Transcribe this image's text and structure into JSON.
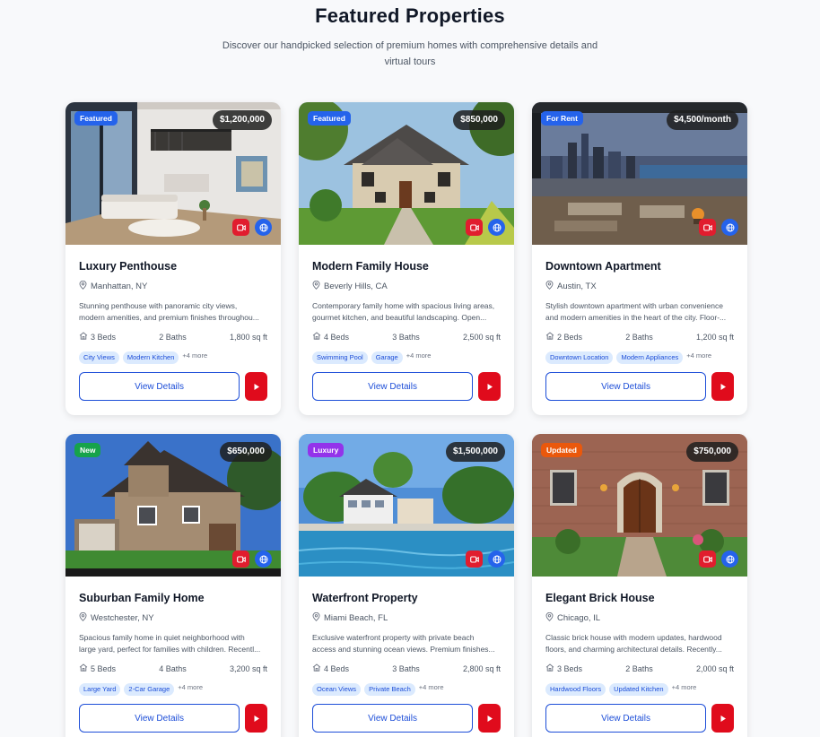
{
  "header": {
    "title": "Featured Properties",
    "subtitle": "Discover our handpicked selection of premium homes with comprehensive details and virtual tours"
  },
  "colors": {
    "accent_blue": "#1d4ed8",
    "video_red": "#e11d2e",
    "badge_featured": "#2563eb",
    "badge_rent": "#2563eb",
    "badge_new": "#16a34a",
    "badge_luxury": "#9333ea",
    "badge_updated": "#ea580c"
  },
  "properties": [
    {
      "badge": "Featured",
      "badge_color": "#2563eb",
      "price": "$1,200,000",
      "title": "Luxury Penthouse",
      "location": "Manhattan, NY",
      "desc_line1": "Stunning penthouse with panoramic city views,",
      "desc_line2": "modern amenities, and premium finishes throughou...",
      "beds": "3 Beds",
      "baths": "2 Baths",
      "sqft": "1,800 sq ft",
      "tags": [
        "City Views",
        "Modern Kitchen"
      ],
      "more": "+4 more",
      "details_label": "View Details",
      "image": "interior"
    },
    {
      "badge": "Featured",
      "badge_color": "#2563eb",
      "price": "$850,000",
      "title": "Modern Family House",
      "location": "Beverly Hills, CA",
      "desc_line1": "Contemporary family home with spacious living areas,",
      "desc_line2": "gourmet kitchen, and beautiful landscaping. Open...",
      "beds": "4 Beds",
      "baths": "3 Baths",
      "sqft": "2,500 sq ft",
      "tags": [
        "Swimming Pool",
        "Garage"
      ],
      "more": "+4 more",
      "details_label": "View Details",
      "image": "house-green"
    },
    {
      "badge": "For Rent",
      "badge_color": "#2563eb",
      "price": "$4,500/month",
      "title": "Downtown Apartment",
      "location": "Austin, TX",
      "desc_line1": "Stylish downtown apartment with urban convenience",
      "desc_line2": "and modern amenities in the heart of the city. Floor-...",
      "beds": "2 Beds",
      "baths": "2 Baths",
      "sqft": "1,200 sq ft",
      "tags": [
        "Downtown Location",
        "Modern Appliances"
      ],
      "more": "+4 more",
      "details_label": "View Details",
      "image": "city-night"
    },
    {
      "badge": "New",
      "badge_color": "#16a34a",
      "price": "$650,000",
      "title": "Suburban Family Home",
      "location": "Westchester, NY",
      "desc_line1": "Spacious family home in quiet neighborhood with",
      "desc_line2": "large yard, perfect for families with children. Recentl...",
      "beds": "5 Beds",
      "baths": "4 Baths",
      "sqft": "3,200 sq ft",
      "tags": [
        "Large Yard",
        "2-Car Garage"
      ],
      "more": "+4 more",
      "details_label": "View Details",
      "image": "stone-house"
    },
    {
      "badge": "Luxury",
      "badge_color": "#9333ea",
      "price": "$1,500,000",
      "title": "Waterfront Property",
      "location": "Miami Beach, FL",
      "desc_line1": "Exclusive waterfront property with private beach",
      "desc_line2": "access and stunning ocean views. Premium finishes...",
      "beds": "4 Beds",
      "baths": "3 Baths",
      "sqft": "2,800 sq ft",
      "tags": [
        "Ocean Views",
        "Private Beach"
      ],
      "more": "+4 more",
      "details_label": "View Details",
      "image": "waterfront"
    },
    {
      "badge": "Updated",
      "badge_color": "#ea580c",
      "price": "$750,000",
      "title": "Elegant Brick House",
      "location": "Chicago, IL",
      "desc_line1": "Classic brick house with modern updates, hardwood",
      "desc_line2": "floors, and charming architectural details. Recently...",
      "beds": "3 Beds",
      "baths": "2 Baths",
      "sqft": "2,000 sq ft",
      "tags": [
        "Hardwood Floors",
        "Updated Kitchen"
      ],
      "more": "+4 more",
      "details_label": "View Details",
      "image": "brick-house"
    }
  ]
}
